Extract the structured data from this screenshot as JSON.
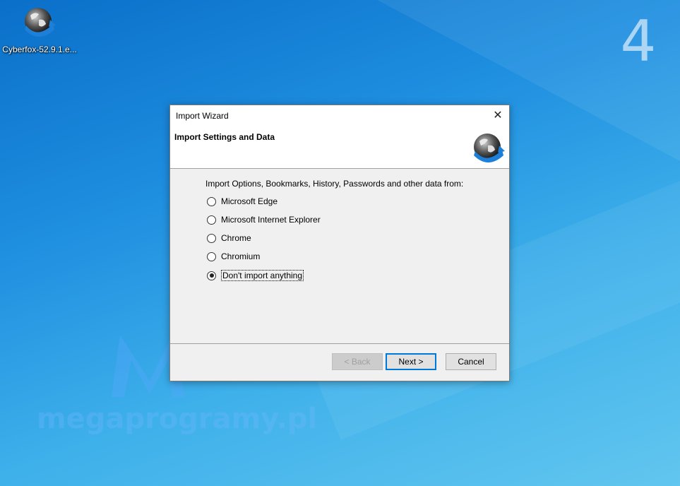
{
  "desktop": {
    "icon_label": "Cyberfox-52.9.1.e...",
    "virtual_desktop_number": "4",
    "watermark_text": "megaprogramy.pl"
  },
  "dialog": {
    "title": "Import Wizard",
    "close_glyph": "✕",
    "header_title": "Import Settings and Data",
    "prompt": "Import Options, Bookmarks, History, Passwords and other data from:",
    "options": [
      {
        "label": "Microsoft Edge",
        "selected": false
      },
      {
        "label": "Microsoft Internet Explorer",
        "selected": false
      },
      {
        "label": "Chrome",
        "selected": false
      },
      {
        "label": "Chromium",
        "selected": false
      },
      {
        "label": "Don't import anything",
        "selected": true
      }
    ],
    "buttons": {
      "back": "< Back",
      "next": "Next >",
      "cancel": "Cancel"
    }
  },
  "icons": {
    "app_icon": "cyberfox-globe-icon",
    "close_icon": "close-icon"
  },
  "colors": {
    "accent": "#0078d7",
    "desktop_blue": "#1f8fe0"
  }
}
